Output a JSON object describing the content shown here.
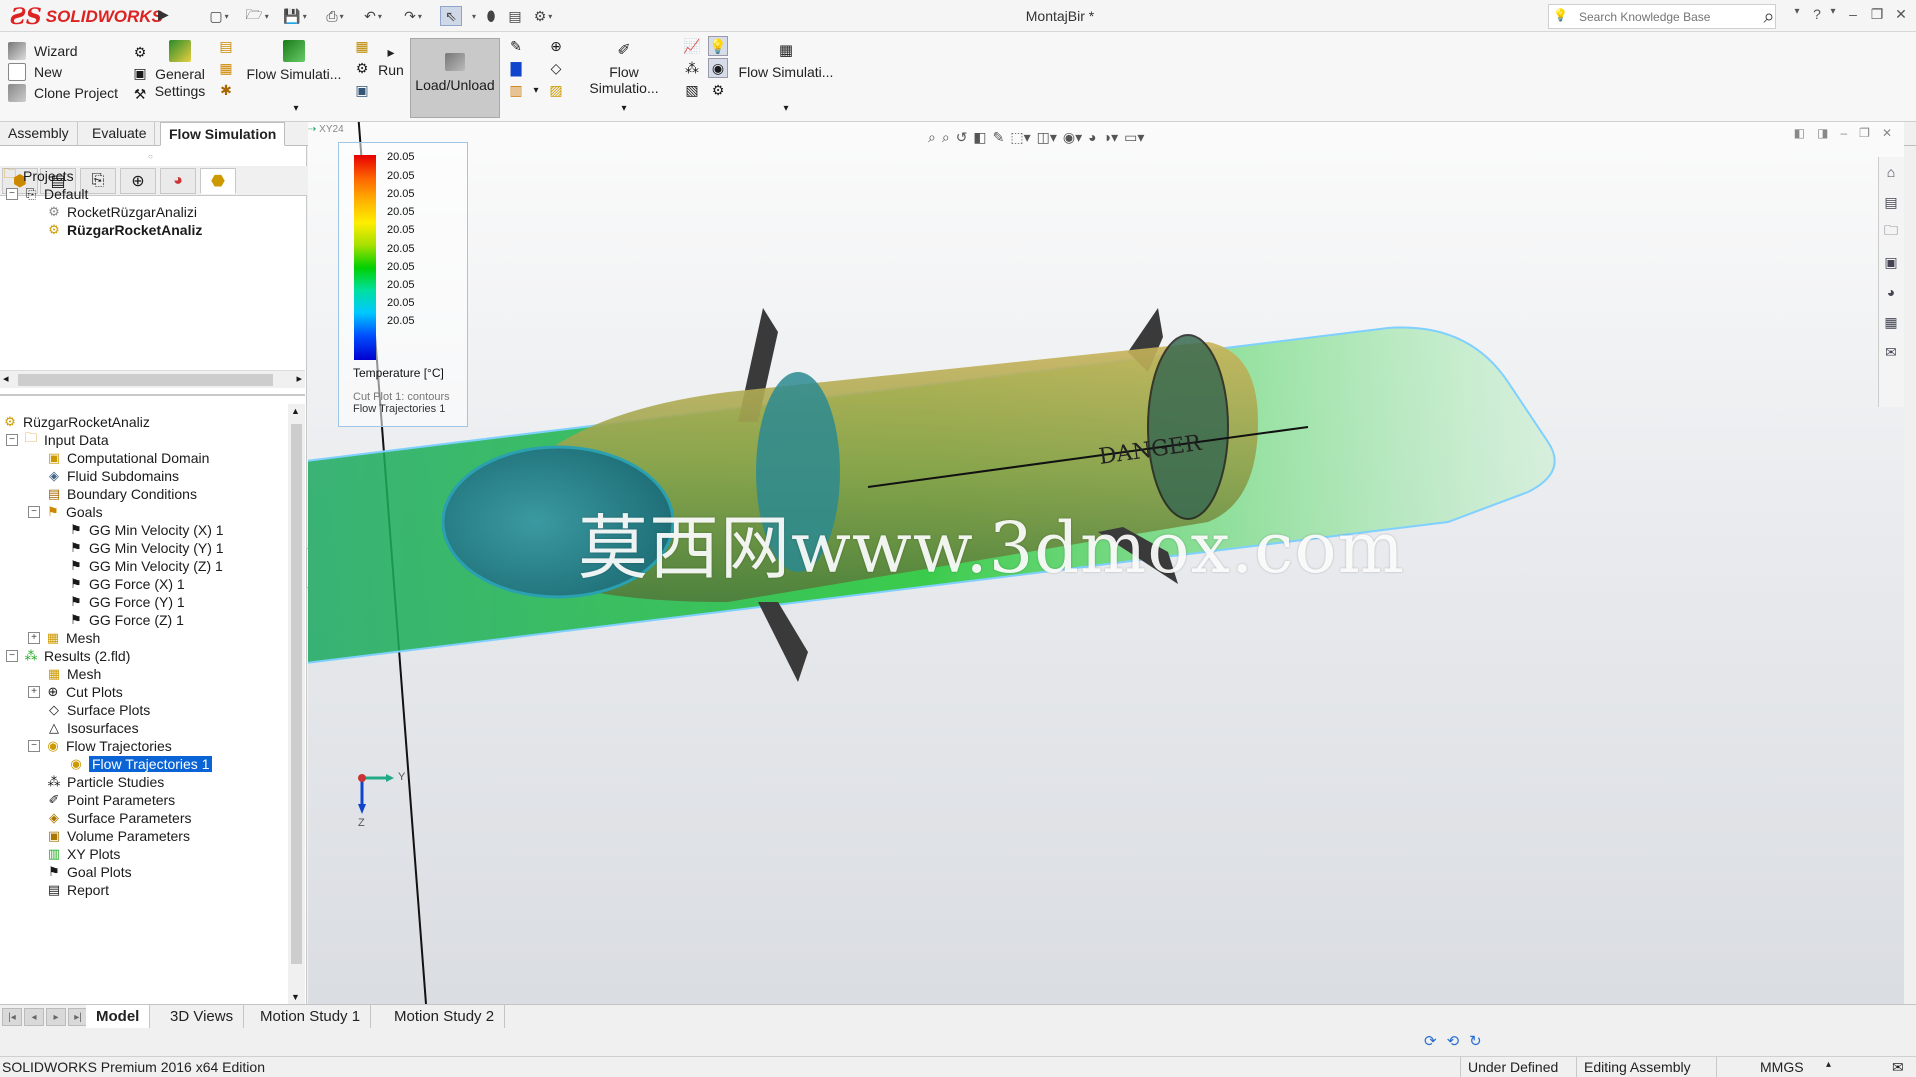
{
  "app": {
    "title": "MontajBir *",
    "search_placeholder": "Search Knowledge Base",
    "help_label": "?"
  },
  "command_manager": {
    "col1": [
      "Wizard",
      "New",
      "Clone Project"
    ],
    "general_settings": "General\nSettings",
    "flow_sim_1": "Flow Simulati...",
    "run": "Run",
    "load_unload": "Load/Unload",
    "flow_sim_2": "Flow Simulatio...",
    "flow_sim_3": "Flow Simulati..."
  },
  "tabs": [
    "Assembly",
    "Evaluate",
    "Flow Simulation"
  ],
  "active_tab": "Flow Simulation",
  "projects_tree": {
    "root": "Projects",
    "default": "Default",
    "items": [
      "RocketRüzgarAnalizi",
      "RüzgarRocketAnaliz"
    ]
  },
  "analysis_tree": {
    "root": "RüzgarRocketAnaliz",
    "input_data": "Input Data",
    "input_children": [
      "Computational Domain",
      "Fluid Subdomains",
      "Boundary Conditions"
    ],
    "goals": "Goals",
    "goal_children": [
      "GG Min Velocity (X) 1",
      "GG Min Velocity (Y) 1",
      "GG Min Velocity (Z) 1",
      "GG Force (X) 1",
      "GG Force (Y) 1",
      "GG Force (Z) 1"
    ],
    "mesh": "Mesh",
    "results": "Results (2.fld)",
    "results_children_a": [
      "Mesh",
      "Cut Plots",
      "Surface Plots",
      "Isosurfaces"
    ],
    "flow_trajectories": "Flow Trajectories",
    "flow_trajectories_child": "Flow Trajectories 1",
    "results_children_b": [
      "Particle Studies",
      "Point Parameters",
      "Surface Parameters",
      "Volume Parameters",
      "XY Plots",
      "Goal Plots",
      "Report"
    ]
  },
  "legend": {
    "values": [
      "20.05",
      "20.05",
      "20.05",
      "20.05",
      "20.05",
      "20.05",
      "20.05",
      "20.05",
      "20.05",
      "20.05"
    ],
    "title": "Temperature [°C]",
    "sub1": "Cut Plot 1: contours",
    "sub2": "Flow Trajectories 1"
  },
  "viewport": {
    "watermark": "莫西网www.3dmox.com",
    "decal_text": "DANGER",
    "axis_y": "Y",
    "axis_z": "Z",
    "plane_label": "XY24"
  },
  "bottom_tabs": [
    "Model",
    "3D Views",
    "Motion Study 1",
    "Motion Study 2"
  ],
  "active_bottom_tab": "Model",
  "status": {
    "edition": "SOLIDWORKS Premium 2016 x64 Edition",
    "defined": "Under Defined",
    "mode": "Editing Assembly",
    "units": "MMGS"
  },
  "colors": {
    "accent_red": "#d22222",
    "selection_blue": "#0a64d6",
    "flow_green": "#2fcf3a"
  }
}
